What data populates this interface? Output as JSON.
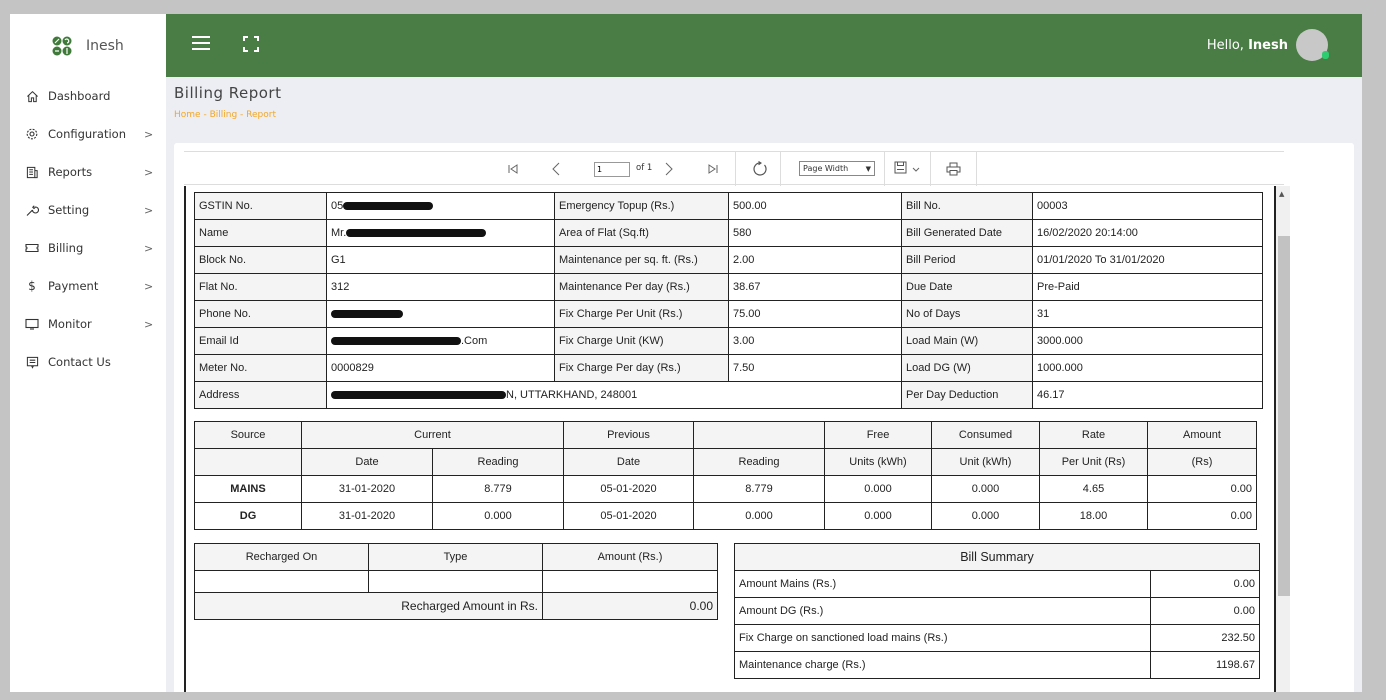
{
  "brand": {
    "name": "Inesh"
  },
  "header": {
    "greeting": "Hello,",
    "user": "Inesh"
  },
  "sidebar": {
    "items": [
      {
        "label": "Dashboard",
        "icon": "home-icon",
        "has_submenu": false
      },
      {
        "label": "Configuration",
        "icon": "gear-icon",
        "has_submenu": true
      },
      {
        "label": "Reports",
        "icon": "report-icon",
        "has_submenu": true
      },
      {
        "label": "Setting",
        "icon": "wrench-icon",
        "has_submenu": true
      },
      {
        "label": "Billing",
        "icon": "ticket-icon",
        "has_submenu": true
      },
      {
        "label": "Payment",
        "icon": "dollar-icon",
        "has_submenu": true
      },
      {
        "label": "Monitor",
        "icon": "monitor-icon",
        "has_submenu": true
      },
      {
        "label": "Contact Us",
        "icon": "message-icon",
        "has_submenu": false
      }
    ],
    "chevron": ">"
  },
  "page": {
    "title": "Billing Report",
    "breadcrumb": [
      "Home",
      "Billing",
      "Report"
    ],
    "separator": "-"
  },
  "viewer": {
    "page_current": "1",
    "page_of": "of 1",
    "zoom": "Page Width",
    "zoom_arrow": "▼"
  },
  "info_rows": [
    {
      "l1": "GSTIN No.",
      "v1": "05",
      "l2": "Emergency Topup (Rs.)",
      "v2": "500.00",
      "l3": "Bill No.",
      "v3": "00003"
    },
    {
      "l1": "Name",
      "v1": "Mr.",
      "l2": "Area of Flat (Sq.ft)",
      "v2": "580",
      "l3": "Bill Generated Date",
      "v3": "16/02/2020 20:14:00"
    },
    {
      "l1": "Block No.",
      "v1": "G1",
      "l2": "Maintenance per sq. ft. (Rs.)",
      "v2": "2.00",
      "l3": "Bill Period",
      "v3": "01/01/2020 To 31/01/2020"
    },
    {
      "l1": "Flat No.",
      "v1": "312",
      "l2": "Maintenance Per day (Rs.)",
      "v2": "38.67",
      "l3": "Due Date",
      "v3": "Pre-Paid"
    },
    {
      "l1": "Phone No.",
      "v1": "",
      "l2": "Fix Charge Per Unit (Rs.)",
      "v2": "75.00",
      "l3": "No of Days",
      "v3": "31"
    },
    {
      "l1": "Email Id",
      "v1": ".Com",
      "l2": "Fix Charge Unit (KW)",
      "v2": "3.00",
      "l3": "Load Main (W)",
      "v3": "3000.000"
    },
    {
      "l1": "Meter No.",
      "v1": "0000829",
      "l2": "Fix Charge Per day (Rs.)",
      "v2": "7.50",
      "l3": "Load DG (W)",
      "v3": "1000.000"
    }
  ],
  "address": {
    "label": "Address",
    "value": "N, UTTARKHAND, 248001",
    "l3": "Per Day Deduction",
    "v3": "46.17"
  },
  "meter_table": {
    "header1": [
      "Source",
      "Current",
      "Previous",
      "",
      "Free",
      "Consumed",
      "Rate",
      "Amount"
    ],
    "header2": [
      "",
      "Date",
      "Reading",
      "Date",
      "Reading",
      "Units (kWh)",
      "Unit (kWh)",
      "Per Unit (Rs)",
      "(Rs)"
    ],
    "rows": [
      [
        "MAINS",
        "31-01-2020",
        "8.779",
        "05-01-2020",
        "8.779",
        "0.000",
        "0.000",
        "4.65",
        "0.00"
      ],
      [
        "DG",
        "31-01-2020",
        "0.000",
        "05-01-2020",
        "0.000",
        "0.000",
        "0.000",
        "18.00",
        "0.00"
      ]
    ]
  },
  "recharge": {
    "headers": [
      "Recharged On",
      "Type",
      "Amount (Rs.)"
    ],
    "total_label": "Recharged Amount in Rs.",
    "total_value": "0.00"
  },
  "summary": {
    "title": "Bill Summary",
    "rows": [
      {
        "label": "Amount Mains (Rs.)",
        "value": "0.00"
      },
      {
        "label": "Amount DG  (Rs.)",
        "value": "0.00"
      },
      {
        "label": "Fix Charge on sanctioned load mains  (Rs.)",
        "value": "232.50"
      },
      {
        "label": "Maintenance charge  (Rs.)",
        "value": "1198.67"
      }
    ]
  },
  "colors": {
    "header_bg": "#4a7d45",
    "breadcrumb": "#f5a623",
    "status_dot": "#2ecc71"
  }
}
